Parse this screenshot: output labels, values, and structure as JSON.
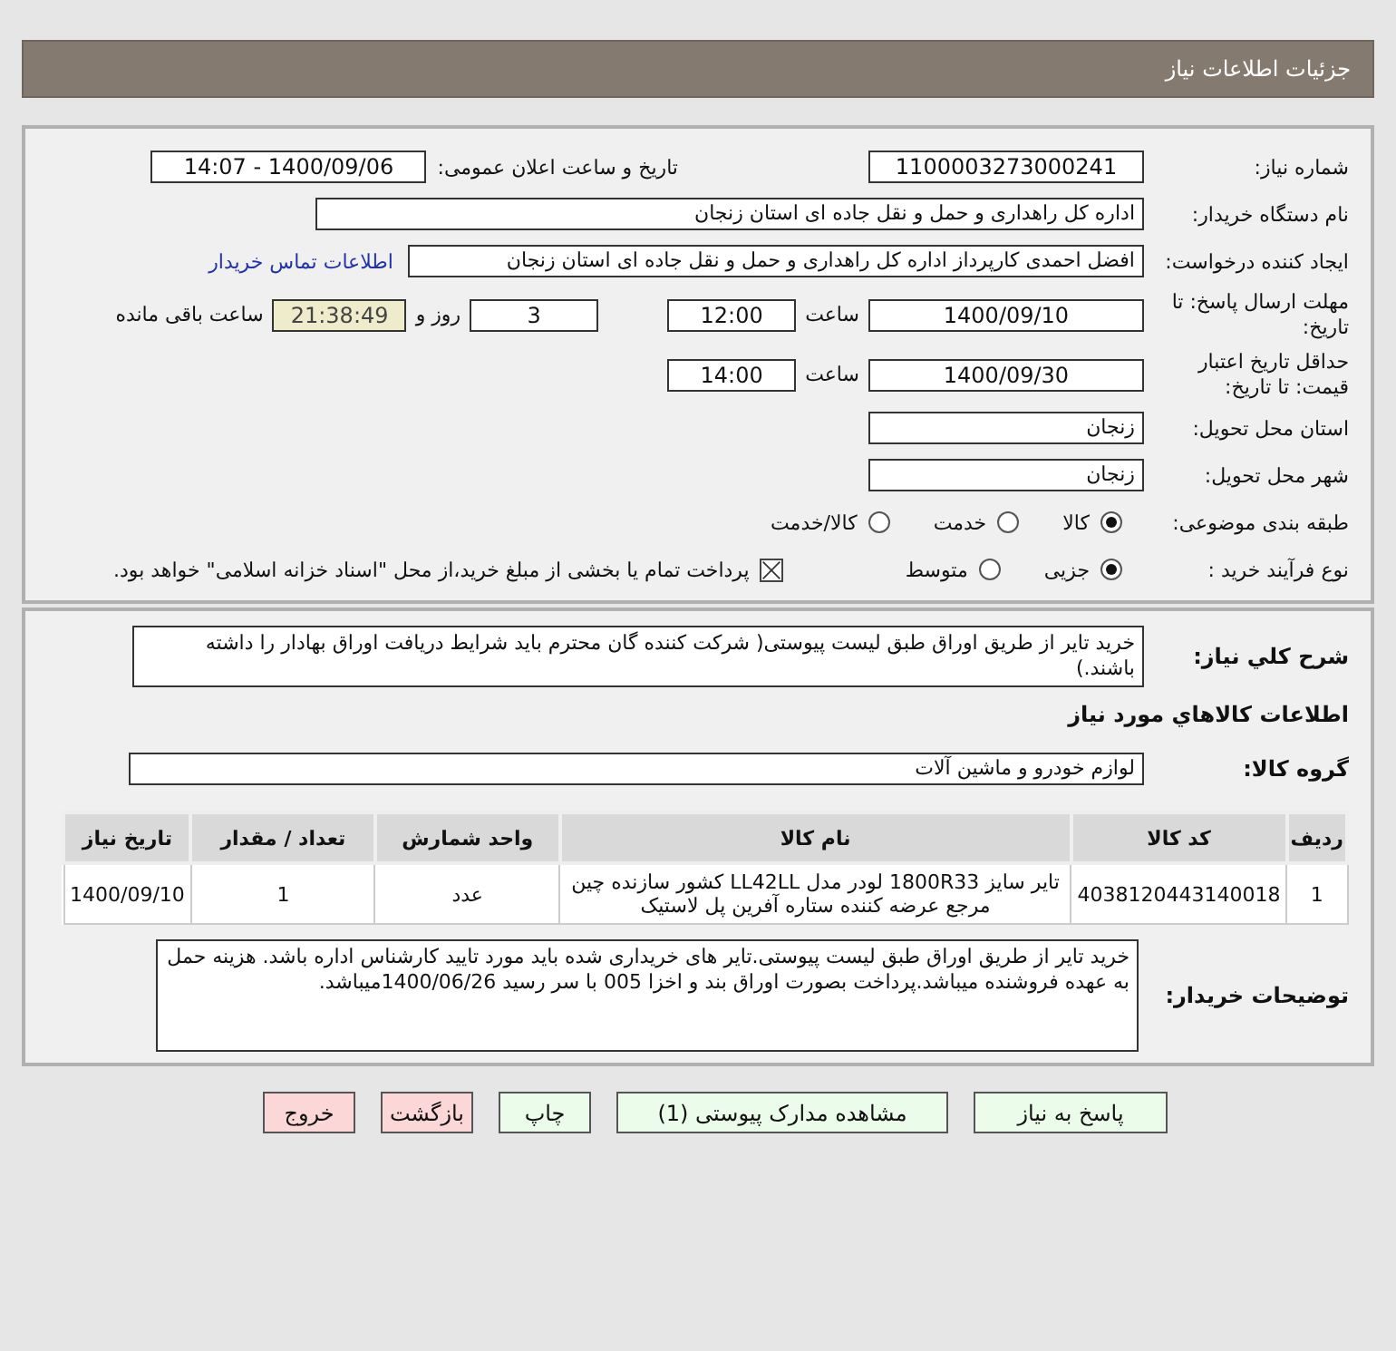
{
  "header": {
    "title": "جزئیات اطلاعات نیاز"
  },
  "need_number": {
    "label": "شماره نیاز:",
    "value": "1100003273000241"
  },
  "announce": {
    "label": "تاریخ و ساعت اعلان عمومی:",
    "value": "1400/09/06 - 14:07"
  },
  "buyer_org": {
    "label": "نام دستگاه خریدار:",
    "value": "اداره کل راهداری و حمل و نقل جاده ای استان زنجان"
  },
  "requester": {
    "label": "ایجاد کننده درخواست:",
    "value": "افضل احمدی کارپرداز اداره کل راهداری و حمل و نقل جاده ای استان زنجان",
    "link": "اطلاعات تماس خریدار"
  },
  "deadline": {
    "label": "مهلت ارسال پاسخ: تا تاریخ:",
    "date": "1400/09/10",
    "time_label": "ساعت",
    "time": "12:00",
    "days": "3",
    "days_label": "روز و",
    "remaining": "21:38:49",
    "remaining_label": "ساعت باقی مانده"
  },
  "validity": {
    "label": "حداقل تاریخ اعتبار قیمت: تا تاریخ:",
    "date": "1400/09/30",
    "time_label": "ساعت",
    "time": "14:00"
  },
  "province": {
    "label": "استان محل تحویل:",
    "value": "زنجان"
  },
  "city": {
    "label": "شهر محل تحویل:",
    "value": "زنجان"
  },
  "category": {
    "label": "طبقه بندی موضوعی:",
    "options": [
      {
        "label": "کالا",
        "selected": true
      },
      {
        "label": "خدمت",
        "selected": false
      },
      {
        "label": "کالا/خدمت",
        "selected": false
      }
    ]
  },
  "process": {
    "label": "نوع فرآیند خرید :",
    "options": [
      {
        "label": "جزیی",
        "selected": true
      },
      {
        "label": "متوسط",
        "selected": false
      }
    ],
    "payment": {
      "checked": true,
      "text": "پرداخت تمام یا بخشی از مبلغ خرید،از محل \"اسناد خزانه اسلامی\" خواهد بود."
    }
  },
  "description": {
    "label": "شرح کلي نياز:",
    "value": "خرید تایر از طریق اوراق طبق لیست پیوستی( شرکت کننده گان محترم باید شرایط دریافت اوراق بهادار را داشته باشند.)"
  },
  "items_heading": "اطلاعات کالاهاي مورد نياز",
  "group": {
    "label": "گروه کالا:",
    "value": "لوازم خودرو و ماشین آلات"
  },
  "table": {
    "columns": [
      "ردیف",
      "کد کالا",
      "نام کالا",
      "واحد شمارش",
      "تعداد / مقدار",
      "تاریخ نیاز"
    ],
    "rows": [
      [
        "1",
        "4038120443140018",
        "تایر سایز 1800R33 لودر مدل LL42LL کشور سازنده چین مرجع عرضه کننده ستاره آفرین پل لاستیک",
        "عدد",
        "1",
        "1400/09/10"
      ]
    ]
  },
  "buyer_notes": {
    "label": "توضیحات خریدار:",
    "value": "خرید تایر از طریق اوراق طبق لیست پیوستی.تایر های خریداری شده باید مورد تایید کارشناس اداره باشد. هزینه حمل به عهده فروشنده میباشد.پرداخت بصورت اوراق بند و اخزا 005 با سر رسید 1400/06/26میباشد."
  },
  "buttons": [
    {
      "label": "پاسخ به نیاز",
      "kind": "action"
    },
    {
      "label": "مشاهده مدارک پیوستی (1)",
      "kind": "action"
    },
    {
      "label": "چاپ",
      "kind": "action"
    },
    {
      "label": "بازگشت",
      "kind": "exit"
    },
    {
      "label": "خروج",
      "kind": "exit"
    }
  ]
}
